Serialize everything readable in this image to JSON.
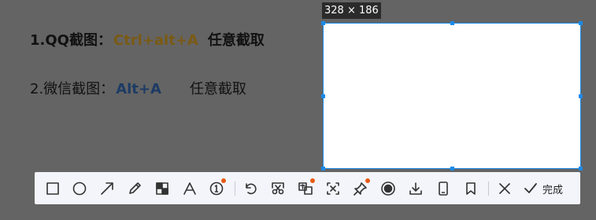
{
  "document": {
    "line1": {
      "prefix": "1.QQ截图：",
      "hotkey": "Ctrl+alt+A",
      "action": "任意截取"
    },
    "line2": {
      "prefix": "2.微信截图：",
      "hotkey": "Alt+A",
      "action": "任意截取"
    }
  },
  "capture": {
    "dimensions": "328 × 186"
  },
  "toolbar": {
    "tools": [
      "rectangle-icon",
      "ellipse-icon",
      "arrow-icon",
      "pen-icon",
      "mosaic-icon",
      "text-icon",
      "number-marker-icon",
      "undo-icon",
      "cut-icon",
      "translate-icon",
      "ocr-icon",
      "pin-icon",
      "record-icon",
      "download-icon",
      "phone-icon",
      "bookmark-icon"
    ],
    "new_badge_color": "#e85a12",
    "cancel_icon": "close-icon",
    "done_label": "完成"
  },
  "colors": {
    "selection_border": "#1a8ae8",
    "qq_hotkey": "#7a5a14",
    "wechat_hotkey": "#1d3b63"
  }
}
